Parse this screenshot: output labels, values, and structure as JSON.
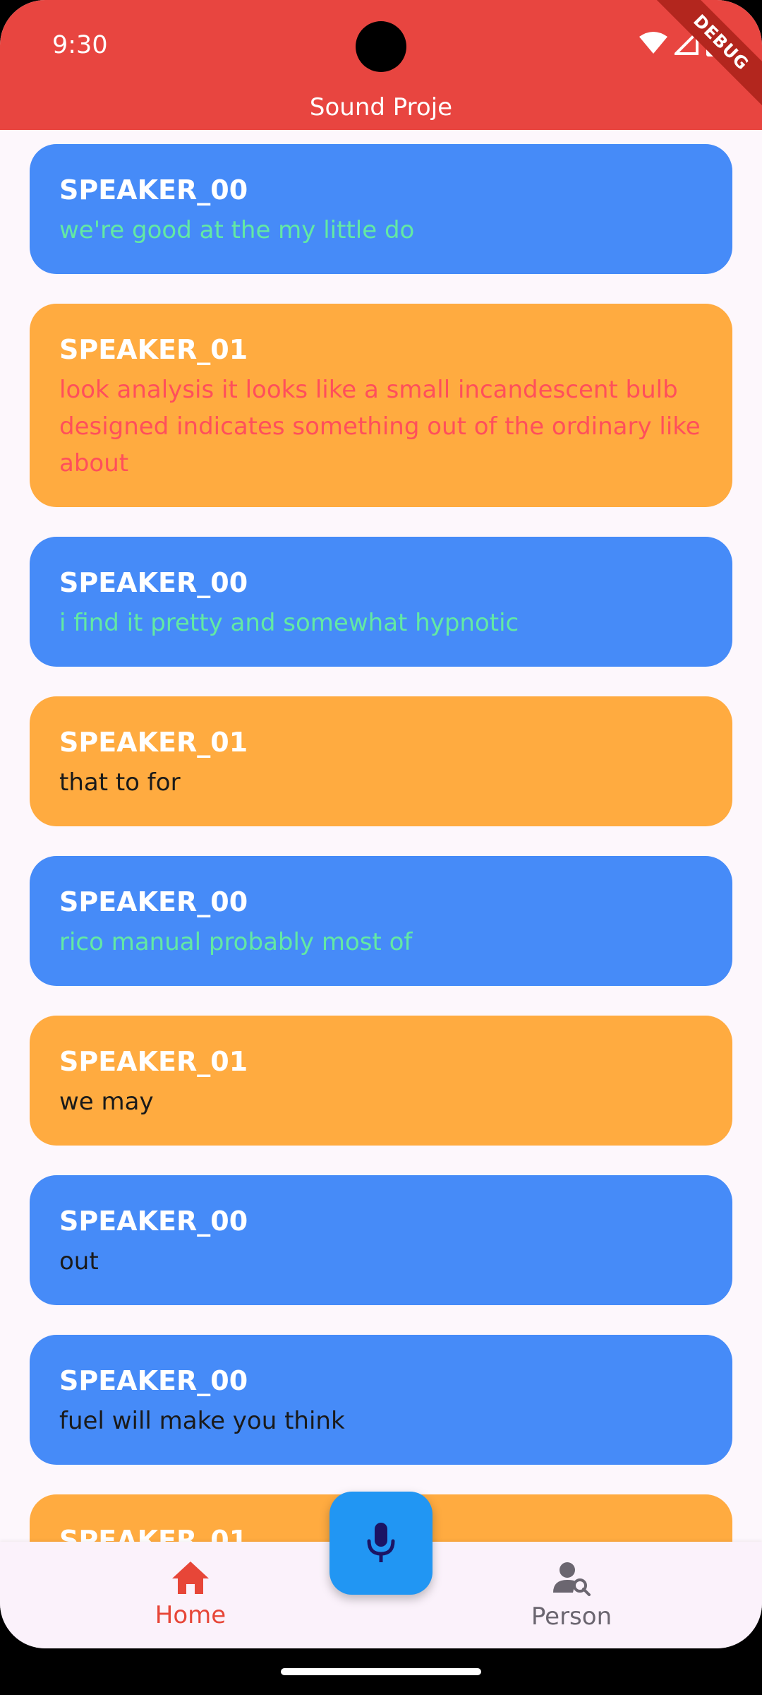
{
  "status_bar": {
    "time": "9:30"
  },
  "debug_banner": "DEBUG",
  "app_bar": {
    "title": "Sound Proje"
  },
  "messages": [
    {
      "speaker": "SPEAKER_00",
      "text": "we're good at the my little do",
      "card_color": "#468bf8",
      "text_color": "#63e9a3"
    },
    {
      "speaker": "SPEAKER_01",
      "text": "look analysis it looks like a small incandescent bulb designed indicates something out of the ordinary like about",
      "card_color": "#ffab40",
      "text_color": "#ff4f5b"
    },
    {
      "speaker": "SPEAKER_00",
      "text": "i find it pretty and somewhat hypnotic",
      "card_color": "#468bf8",
      "text_color": "#63e9a3"
    },
    {
      "speaker": "SPEAKER_01",
      "text": "that to for",
      "card_color": "#ffab40",
      "text_color": "#1a1a1a"
    },
    {
      "speaker": "SPEAKER_00",
      "text": "rico manual probably most of",
      "card_color": "#468bf8",
      "text_color": "#63e9a3"
    },
    {
      "speaker": "SPEAKER_01",
      "text": "we may",
      "card_color": "#ffab40",
      "text_color": "#1a1a1a"
    },
    {
      "speaker": "SPEAKER_00",
      "text": "out",
      "card_color": "#468bf8",
      "text_color": "#1a1a1a"
    },
    {
      "speaker": "SPEAKER_00",
      "text": "fuel will make you think",
      "card_color": "#468bf8",
      "text_color": "#1a1a1a"
    },
    {
      "speaker": "SPEAKER_01",
      "text": "",
      "card_color": "#ffab40",
      "text_color": "#1a1a1a"
    }
  ],
  "bottom_nav": {
    "home": {
      "label": "Home",
      "icon": "home-icon",
      "active_color": "#e74638"
    },
    "person": {
      "label": "Person",
      "icon": "person-search-icon"
    }
  },
  "fab": {
    "icon": "microphone-icon",
    "color": "#2196f3"
  }
}
